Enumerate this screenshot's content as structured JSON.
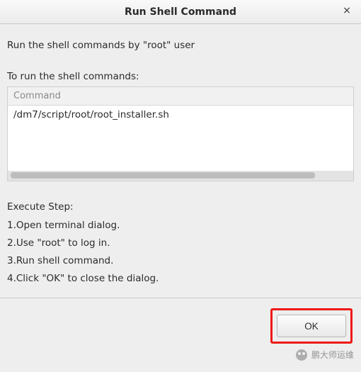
{
  "title": "Run Shell Command",
  "description": "Run the shell commands by \"root\" user",
  "run_label": "To run the shell commands:",
  "table": {
    "header": "Command",
    "rows": [
      "/dm7/script/root/root_installer.sh"
    ]
  },
  "execute_label": "Execute Step:",
  "steps": [
    "1.Open terminal dialog.",
    "2.Use \"root\" to log in.",
    "3.Run shell command.",
    "4.Click \"OK\" to close the dialog."
  ],
  "buttons": {
    "ok": "OK"
  },
  "close_glyph": "×",
  "watermark": "鹏大师运维"
}
